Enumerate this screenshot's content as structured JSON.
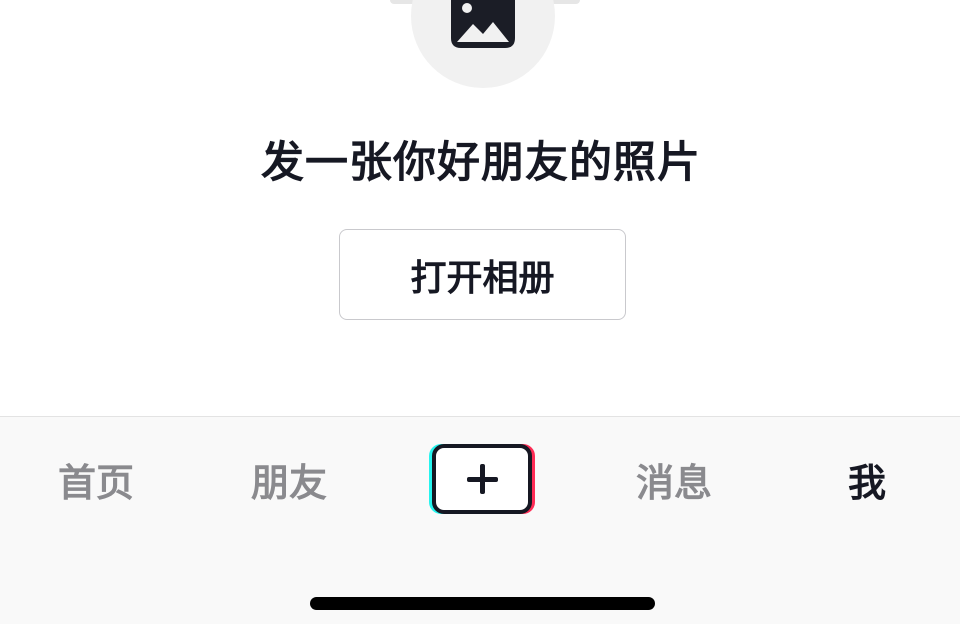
{
  "prompt": {
    "text": "发一张你好朋友的照片"
  },
  "open_album": {
    "label": "打开相册"
  },
  "tabbar": {
    "home": "首页",
    "friends": "朋友",
    "create_icon": "plus-icon",
    "messages": "消息",
    "me": "我",
    "active": "me"
  },
  "colors": {
    "text_primary": "#161823",
    "text_inactive": "#8a8a8e",
    "accent_cyan": "#25f4ee",
    "accent_red": "#fe2c55"
  }
}
